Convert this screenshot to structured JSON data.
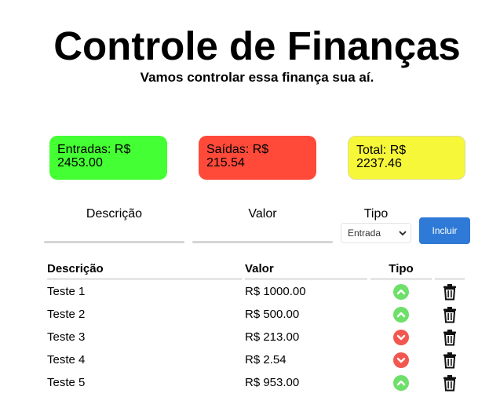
{
  "header": {
    "title": "Controle de Finanças",
    "subtitle": "Vamos controlar essa finança sua aí."
  },
  "summary": {
    "income_label": "Entradas: R$",
    "income_value": "2453.00",
    "expense_label": "Saídas: R$",
    "expense_value": "215.54",
    "total_label": "Total: R$",
    "total_value": "2237.46",
    "income_color": "#44ff33",
    "expense_color": "#ff4a3a",
    "total_color": "#f7f73a"
  },
  "form": {
    "description_label": "Descrição",
    "value_label": "Valor",
    "type_label": "Tipo",
    "type_selected": "Entrada",
    "submit_label": "Incluir",
    "button_color": "#2f7ad6"
  },
  "table": {
    "headers": [
      "Descrição",
      "Valor",
      "Tipo",
      ""
    ],
    "rows": [
      {
        "description": "Teste 1",
        "value": "R$ 1000.00",
        "type": "income",
        "type_icon": "chevron-up-icon"
      },
      {
        "description": "Teste 2",
        "value": "R$ 500.00",
        "type": "income",
        "type_icon": "chevron-up-icon"
      },
      {
        "description": "Teste 3",
        "value": "R$ 213.00",
        "type": "expense",
        "type_icon": "chevron-down-icon"
      },
      {
        "description": "Teste 4",
        "value": "R$ 2.54",
        "type": "expense",
        "type_icon": "chevron-down-icon"
      },
      {
        "description": "Teste 5",
        "value": "R$ 953.00",
        "type": "income",
        "type_icon": "chevron-up-icon"
      }
    ],
    "income_icon_color": "#6ee06a",
    "expense_icon_color": "#f2574f",
    "delete_icon": "trash-icon"
  }
}
